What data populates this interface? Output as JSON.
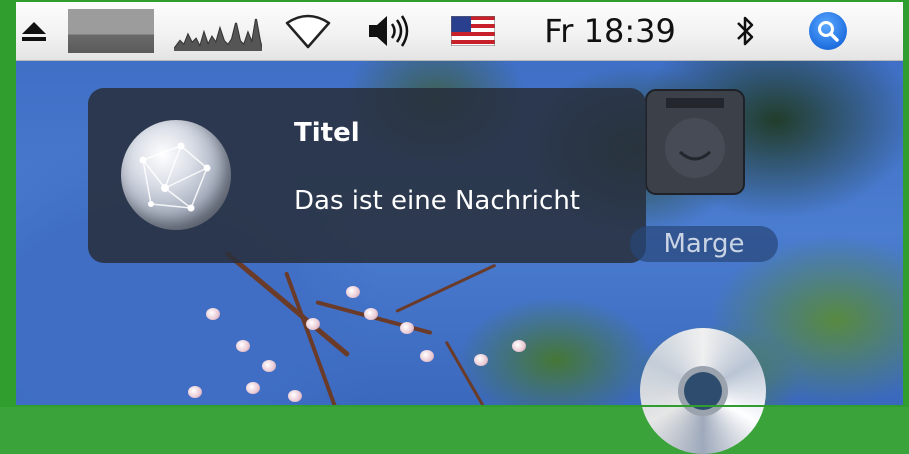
{
  "menubar": {
    "clock": "Fr 18:39",
    "icons": [
      "eject-icon",
      "cpu-meter-icon",
      "activity-graph-icon",
      "wifi-icon",
      "volume-icon",
      "us-flag-input-icon",
      "bluetooth-icon",
      "spotlight-icon"
    ],
    "spotlight_color": "#1f6fe0"
  },
  "notification": {
    "title": "Titel",
    "message": "Das ist eine Nachricht",
    "icon": "network-globe-icon",
    "background": "#28303e"
  },
  "desktop": {
    "volume_label": "Marge",
    "items": [
      "hard-drive-icon",
      "cd-disc-icon"
    ]
  }
}
